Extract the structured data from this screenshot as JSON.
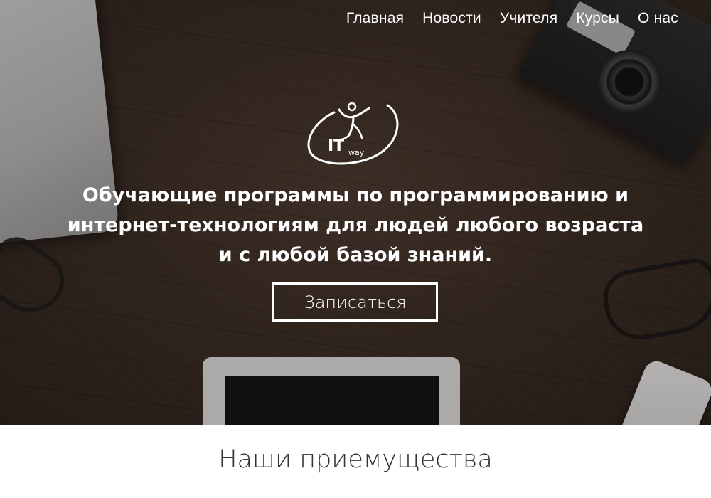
{
  "nav": {
    "items": [
      {
        "label": "Главная"
      },
      {
        "label": "Новости"
      },
      {
        "label": "Учителя"
      },
      {
        "label": "Курсы"
      },
      {
        "label": "О нас"
      }
    ]
  },
  "logo": {
    "text_main": "IT",
    "text_sub": "way"
  },
  "hero": {
    "headline": "Обучающие программы по программированию и интернет-технологиям для людей любого возраста и с любой базой знаний.",
    "cta_label": "Записаться"
  },
  "section": {
    "title": "Наши приемущества"
  },
  "colors": {
    "hero_text": "#ffffff",
    "section_title": "#333333",
    "background": "#ffffff"
  },
  "icons": {
    "logo": "itway-logo-icon"
  }
}
